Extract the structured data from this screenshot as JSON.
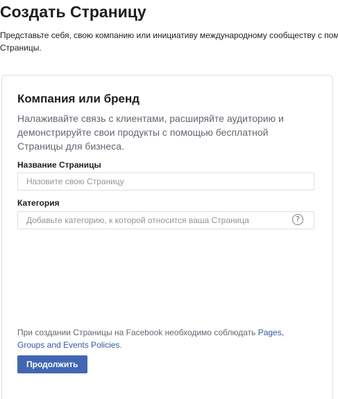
{
  "header": {
    "title": "Создать Страницу",
    "description_line1": "Представьте себя, свою компанию или инициативу международному сообществу с помощью",
    "description_line2": "Страницы."
  },
  "card": {
    "title": "Компания или бренд",
    "description_line1": "Налаживайте связь с клиентами, расширяйте аудиторию и",
    "description_line2": "демонстрируйте свои продукты с помощью бесплатной",
    "description_line3": "Страницы для бизнеса.",
    "page_name": {
      "label": "Название Страницы",
      "placeholder": "Назовите свою Страницу",
      "value": ""
    },
    "category": {
      "label": "Категория",
      "placeholder": "Добавьте категорию, к которой относится ваша Страница",
      "value": "",
      "help_icon": "question-mark-circle-icon",
      "help_glyph": "?"
    },
    "policy": {
      "text_before": "При создании Страницы на Facebook необходимо соблюдать ",
      "link_part1": "Pages,",
      "link_part2": "Groups and Events Policies",
      "text_after": "."
    },
    "continue_label": "Продолжить"
  },
  "colors": {
    "button_bg": "#4267b2",
    "link": "#365899",
    "muted_text": "#606770",
    "border": "#dddfe2"
  }
}
